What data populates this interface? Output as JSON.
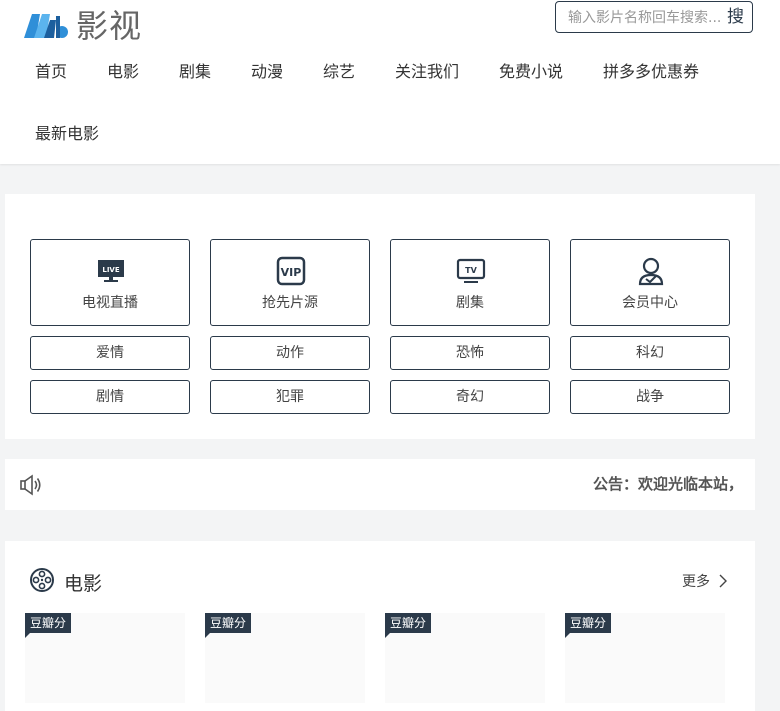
{
  "colors": {
    "accent": "#2b3a4a",
    "background": "#f3f4f5",
    "logo_blue": "#2f8fd8"
  },
  "header": {
    "logo_text": "影视",
    "search_placeholder": "输入影片名称回车搜索...",
    "search_button": "搜"
  },
  "nav": {
    "items": [
      {
        "label": "首页"
      },
      {
        "label": "电影"
      },
      {
        "label": "剧集"
      },
      {
        "label": "动漫"
      },
      {
        "label": "综艺"
      },
      {
        "label": "关注我们"
      },
      {
        "label": "免费小说"
      },
      {
        "label": "拼多多优惠券"
      },
      {
        "label": "最新电影"
      }
    ]
  },
  "quick_links": {
    "featured": [
      {
        "label": "电视直播",
        "icon": "live-tv-icon"
      },
      {
        "label": "抢先片源",
        "icon": "vip-icon"
      },
      {
        "label": "剧集",
        "icon": "tv-icon"
      },
      {
        "label": "会员中心",
        "icon": "user-icon"
      }
    ],
    "genres": [
      {
        "label": "爱情"
      },
      {
        "label": "动作"
      },
      {
        "label": "恐怖"
      },
      {
        "label": "科幻"
      },
      {
        "label": "剧情"
      },
      {
        "label": "犯罪"
      },
      {
        "label": "奇幻"
      },
      {
        "label": "战争"
      }
    ]
  },
  "notice": {
    "icon": "speaker-icon",
    "text": "公告：欢迎光临本站，"
  },
  "movie_section": {
    "title": "电影",
    "icon": "film-reel-icon",
    "more_label": "更多",
    "cards": [
      {
        "badge": "豆瓣分"
      },
      {
        "badge": "豆瓣分"
      },
      {
        "badge": "豆瓣分"
      },
      {
        "badge": "豆瓣分"
      }
    ]
  }
}
